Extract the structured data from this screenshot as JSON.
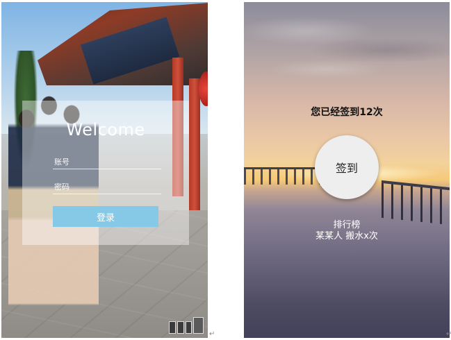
{
  "login": {
    "welcome": "Welcome",
    "username_placeholder": "账号",
    "password_placeholder": "密码",
    "login_button": "登录"
  },
  "checkin": {
    "status_text": "您已经签到12次",
    "checkin_count": 12,
    "checkin_button": "签到",
    "leaderboard_title": "排行榜",
    "leaderboard_items": [
      "某某人 搬水x次"
    ]
  },
  "colors": {
    "login_button": "#86c9e6",
    "overlay": "rgba(255,255,255,0.42)",
    "checkin_button": "#eeeeee"
  },
  "icons": {
    "return_mark": "↵"
  }
}
